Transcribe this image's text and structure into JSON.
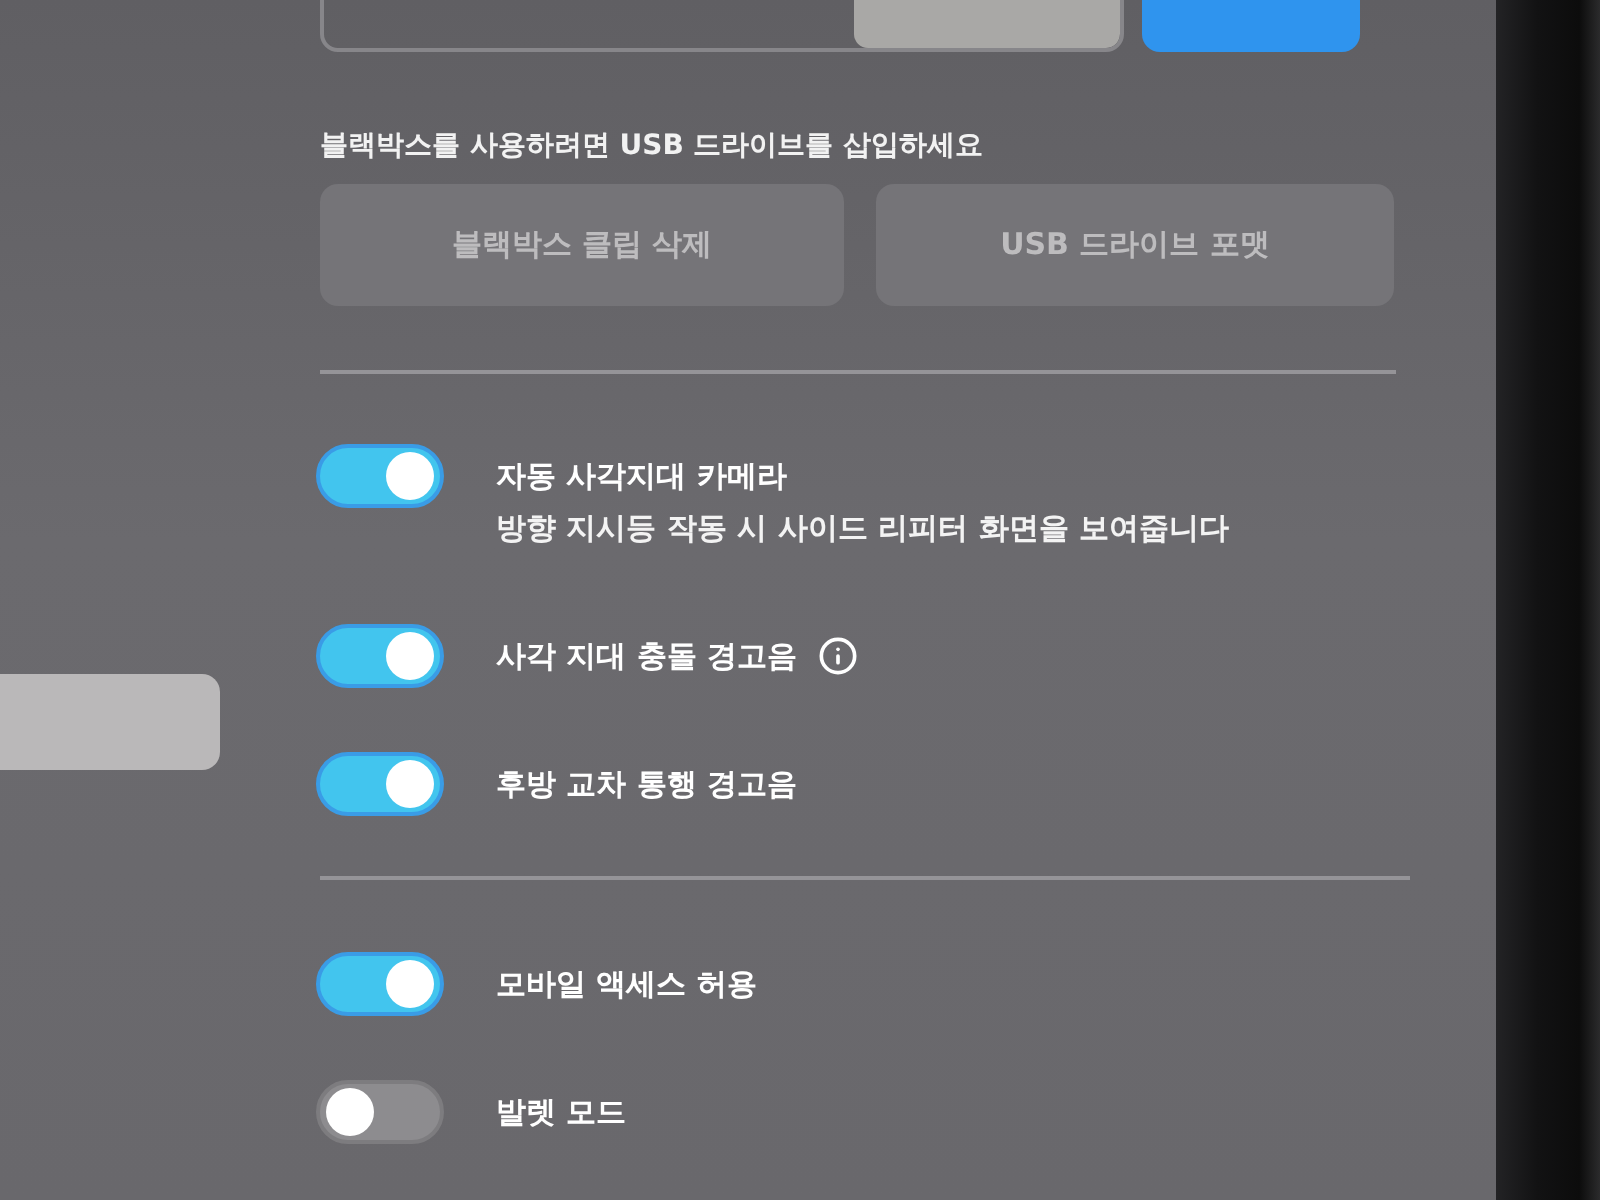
{
  "sidebar": {
    "items": [
      {
        "selected": true
      }
    ]
  },
  "segmented_control": {
    "segments": [
      {
        "selected": false
      },
      {
        "selected": false
      },
      {
        "selected": true
      }
    ]
  },
  "dashcam": {
    "notice": "블랙박스를 사용하려면 USB 드라이브를 삽입하세요",
    "buttons": [
      {
        "label": "블랙박스 클립 삭제",
        "disabled": true
      },
      {
        "label": "USB 드라이브 포맷",
        "disabled": true
      }
    ]
  },
  "settings_groups": [
    [
      {
        "label": "자동 사각지대 카메라",
        "description": "방향 지시등 작동 시 사이드 리피터 화면을 보여줍니다",
        "on": true
      },
      {
        "label": "사각 지대 충돌 경고음",
        "info": true,
        "on": true
      },
      {
        "label": "후방 교차 통행 경고음",
        "on": true
      }
    ],
    [
      {
        "label": "모바일 액세스 허용",
        "on": true
      },
      {
        "label": "발렛 모드",
        "on": false
      }
    ]
  ]
}
